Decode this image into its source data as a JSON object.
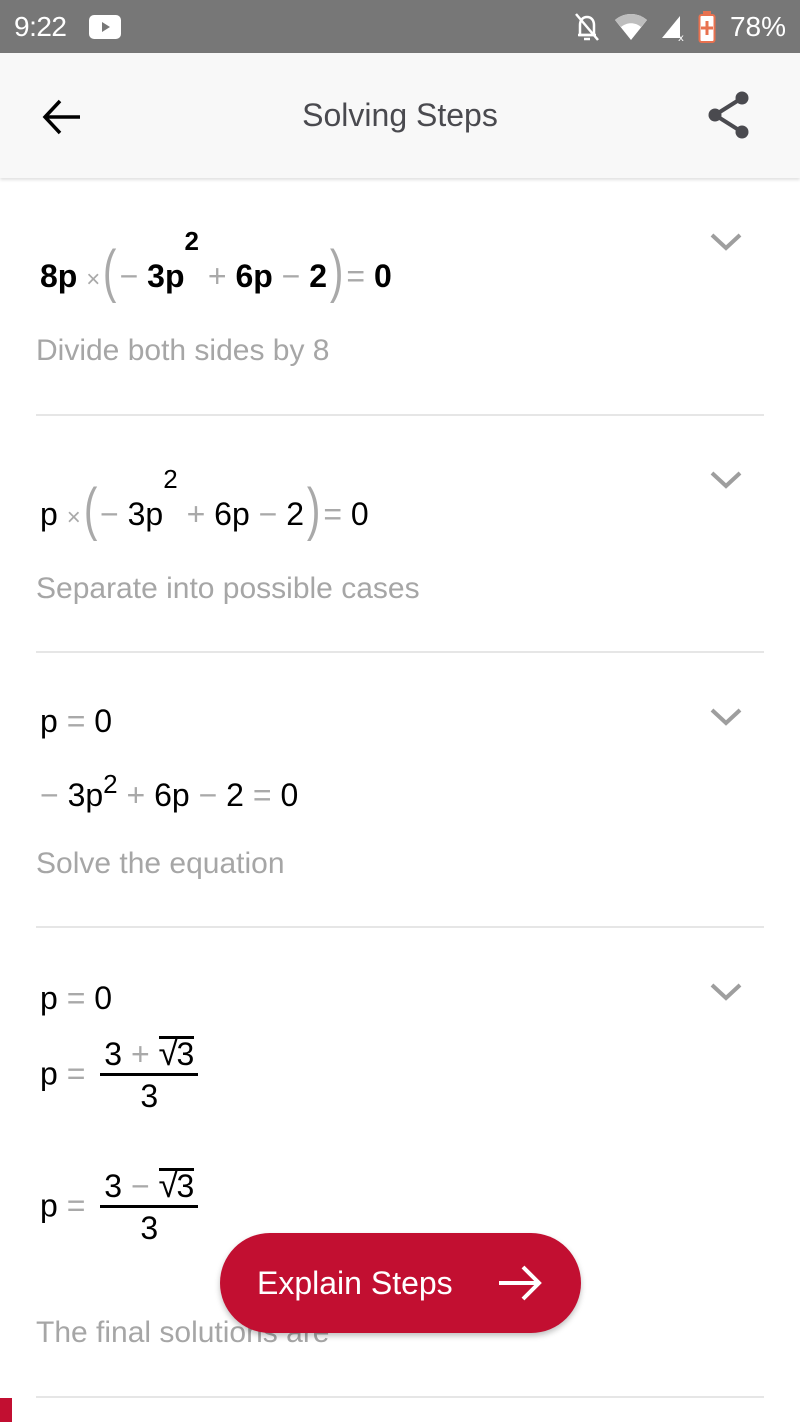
{
  "status_bar": {
    "time": "9:22",
    "battery_percent": "78%",
    "icons": [
      "youtube-icon",
      "mute-bell-icon",
      "wifi-icon",
      "signal-icon",
      "battery-icon"
    ]
  },
  "app_bar": {
    "title": "Solving Steps",
    "back_icon": "arrow-left-icon",
    "share_icon": "share-icon"
  },
  "steps": [
    {
      "expression": {
        "coef": "8p",
        "times": "×",
        "open": "(",
        "neg": "−",
        "term1": "3p",
        "exp": "2",
        "plus": "+",
        "term2": "6p",
        "minus": "−",
        "term3": "2",
        "close": ")",
        "eq": "=",
        "rhs": "0"
      },
      "description": "Divide both sides by 8"
    },
    {
      "expression": {
        "coef": "p",
        "times": "×",
        "open": "(",
        "neg": "−",
        "term1": "3p",
        "exp": "2",
        "plus": "+",
        "term2": "6p",
        "minus": "−",
        "term3": "2",
        "close": ")",
        "eq": "=",
        "rhs": "0"
      },
      "description": "Separate into possible cases"
    },
    {
      "lines": [
        {
          "lhs": "p",
          "eq": "=",
          "rhs": "0"
        },
        {
          "neg": "−",
          "term1": "3p",
          "exp": "2",
          "plus": "+",
          "term2": "6p",
          "minus": "−",
          "term3": "2",
          "eq": "=",
          "rhs": "0"
        }
      ],
      "description": "Solve the equation"
    },
    {
      "lines": [
        {
          "lhs": "p",
          "eq": "=",
          "rhs": "0"
        },
        {
          "lhs": "p",
          "eq": "=",
          "num_a": "3",
          "op": "+",
          "radicand": "3",
          "den": "3"
        },
        {
          "lhs": "p",
          "eq": "=",
          "num_a": "3",
          "op": "−",
          "radicand": "3",
          "den": "3"
        }
      ],
      "description": "The final solutions are"
    }
  ],
  "fab": {
    "label": "Explain Steps",
    "icon": "arrow-right-icon",
    "color": "#c20f31"
  }
}
